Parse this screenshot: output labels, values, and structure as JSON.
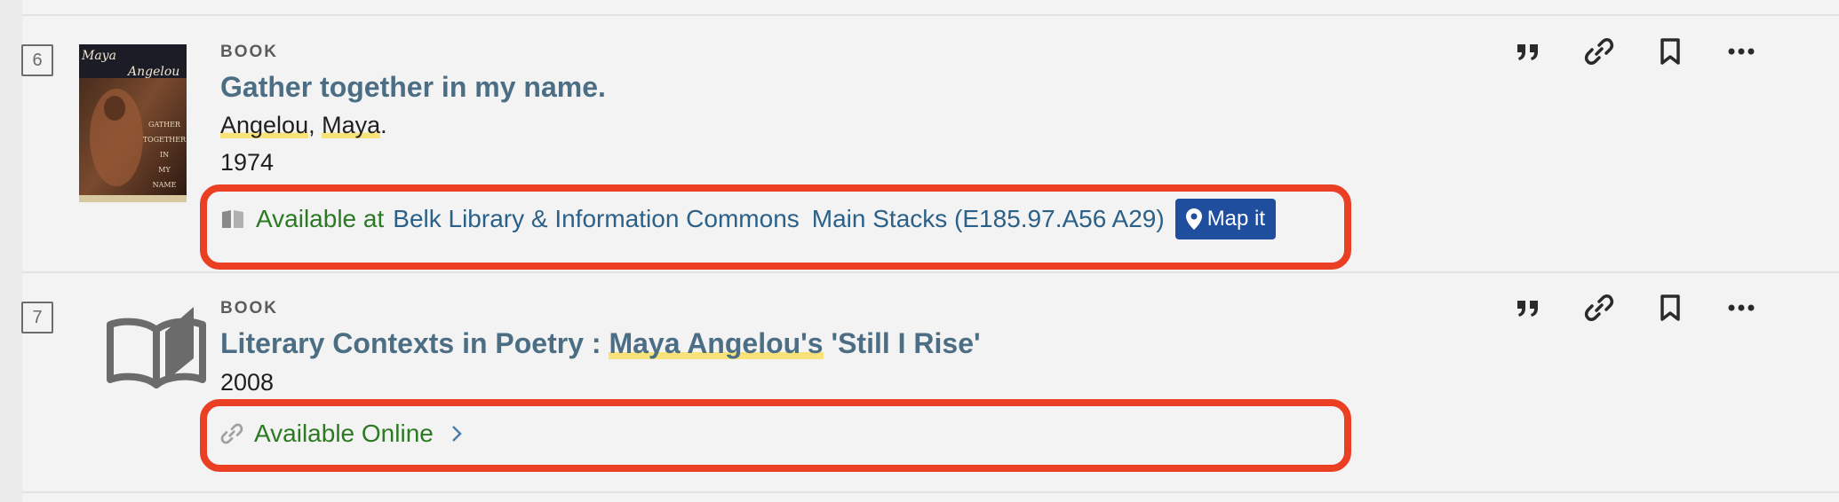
{
  "results": [
    {
      "index": "6",
      "type": "BOOK",
      "title": "Gather together in my name.",
      "author_last": "Angelou",
      "author_first": "Maya",
      "year": "1974",
      "availability_prefix": "Available at",
      "library": "Belk Library & Information Commons",
      "location": "Main Stacks (E185.97.A56 A29)",
      "map_button": "Map it",
      "cover_title_lines": [
        "Maya",
        "Angelou"
      ],
      "cover_subtitle_lines": [
        "GATHER",
        "TOGETHER",
        "IN",
        "MY",
        "NAME"
      ]
    },
    {
      "index": "7",
      "type": "BOOK",
      "title_prefix": "Literary Contexts in Poetry : ",
      "title_highlight": "Maya Angelou's",
      "title_suffix": " 'Still I Rise'",
      "year": "2008",
      "availability": "Available Online"
    }
  ],
  "action_icons": [
    "quote-icon",
    "link-icon",
    "bookmark-icon",
    "more-icon"
  ],
  "colors": {
    "title": "#4c6e84",
    "available": "#2b7a22",
    "location": "#2b6189",
    "map_button": "#1f4e9e",
    "highlight_box": "#ea3f23",
    "search_highlight": "#f8e27a"
  }
}
